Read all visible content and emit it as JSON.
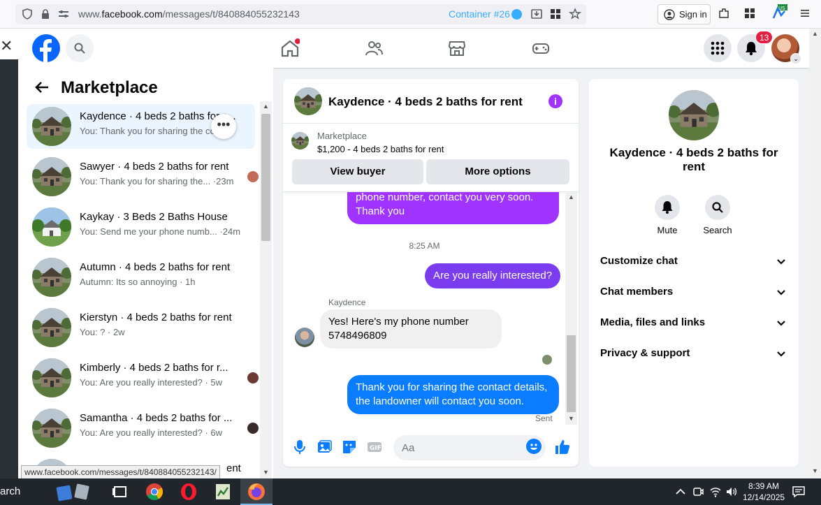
{
  "browser": {
    "url_prefix": "www.",
    "url_domain": "facebook.com",
    "url_path": "/messages/t/840884055232143",
    "container": "Container #26",
    "signin_label": "Sign in",
    "status_url": "www.facebook.com/messages/t/840884055232143/"
  },
  "header": {
    "notif_count": "13"
  },
  "sidebar": {
    "title": "Marketplace",
    "conversations": [
      {
        "title": "Kaydence · 4 beds 2 baths for rent",
        "sub": "You: Thank you for sharing the co… m"
      },
      {
        "title": "Sawyer · 4 beds 2 baths for rent",
        "sub": "You: Thank you for sharing the... ·23m"
      },
      {
        "title": "Kaykay · 3 Beds 2 Baths House",
        "sub": "You: Send me your phone numb... ·24m"
      },
      {
        "title": "Autumn · 4 beds 2 baths for rent",
        "sub": "Autumn: Its so annoying · 1h"
      },
      {
        "title": "Kierstyn · 4 beds 2 baths for rent",
        "sub": "You: ? · 2w"
      },
      {
        "title": "Kimberly · 4 beds 2 baths for r...",
        "sub": "You: Are you really interested? · 5w"
      },
      {
        "title": "Samantha · 4 beds 2 baths for ...",
        "sub": "You: Are you really interested? · 6w"
      },
      {
        "title": "ent",
        "sub": ""
      }
    ]
  },
  "chat": {
    "title": "Kaydence · 4 beds 2 baths for rent",
    "listing_source": "Marketplace",
    "listing_price": "$1,200 - 4 beds 2 baths for rent",
    "view_buyer": "View buyer",
    "more_options": "More options",
    "messages": {
      "m1": "phone number, contact you very soon. Thank you",
      "timestamp": "8:25 AM",
      "m2": "Are you really interested?",
      "sender": "Kaydence",
      "m3": "Yes! Here's my phone number 5748496809",
      "m4": "Thank you for sharing the contact details, the landowner will contact you soon.",
      "sent": "Sent"
    },
    "composer_placeholder": "Aa"
  },
  "info": {
    "title": "Kaydence · 4 beds 2 baths for rent",
    "mute": "Mute",
    "search": "Search",
    "rows": [
      "Customize chat",
      "Chat members",
      "Media, files and links",
      "Privacy & support"
    ]
  },
  "taskbar": {
    "search": "arch",
    "time": "8:39 AM",
    "date": "12/14/2025"
  },
  "colors": {
    "fb_blue": "#0866ff",
    "purple_bubble": "#a033ff",
    "blue_bubble": "#0a7cff",
    "badge_red": "#e41e3f"
  }
}
